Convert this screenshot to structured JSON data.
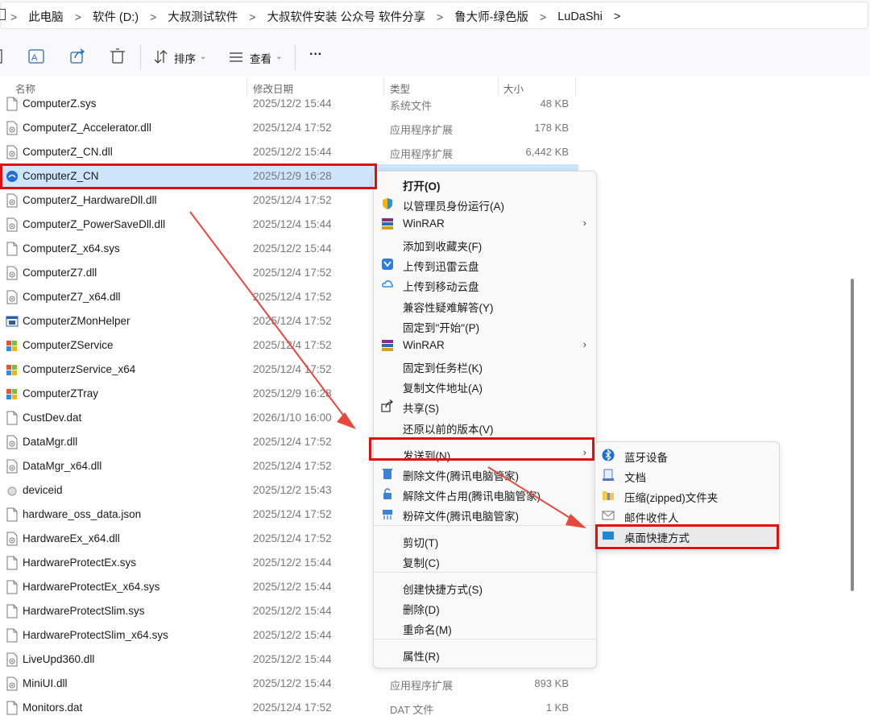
{
  "breadcrumb": [
    "此电脑",
    "软件 (D:)",
    "大叔测试软件",
    "大叔软件安装 公众号 软件分享",
    "鲁大师-绿色版",
    "LuDaShi"
  ],
  "toolbar": {
    "sort_label": "排序",
    "view_label": "查看",
    "more_label": "···"
  },
  "columns": {
    "name": "名称",
    "date": "修改日期",
    "type": "类型",
    "size": "大小"
  },
  "files": [
    {
      "name": "ComputerZ.sys",
      "date": "2025/12/2 15:44",
      "type": "系统文件",
      "size": "48 KB",
      "icon": "file-icon"
    },
    {
      "name": "ComputerZ_Accelerator.dll",
      "date": "2025/12/4 17:52",
      "type": "应用程序扩展",
      "size": "178 KB",
      "icon": "dll-icon"
    },
    {
      "name": "ComputerZ_CN.dll",
      "date": "2025/12/2 15:44",
      "type": "应用程序扩展",
      "size": "6,442 KB",
      "icon": "dll-icon"
    },
    {
      "name": "ComputerZ_CN",
      "date": "2025/12/9 16:28",
      "type": "",
      "size": "",
      "icon": "ludashi-app-icon"
    },
    {
      "name": "ComputerZ_HardwareDll.dll",
      "date": "2025/12/4 17:52",
      "type": "",
      "size": "",
      "icon": "dll-icon"
    },
    {
      "name": "ComputerZ_PowerSaveDll.dll",
      "date": "2025/12/4 15:44",
      "type": "",
      "size": "",
      "icon": "dll-icon"
    },
    {
      "name": "ComputerZ_x64.sys",
      "date": "2025/12/2 15:44",
      "type": "",
      "size": "",
      "icon": "file-icon"
    },
    {
      "name": "ComputerZ7.dll",
      "date": "2025/12/4 17:52",
      "type": "",
      "size": "",
      "icon": "dll-icon"
    },
    {
      "name": "ComputerZ7_x64.dll",
      "date": "2025/12/4 17:52",
      "type": "",
      "size": "",
      "icon": "dll-icon"
    },
    {
      "name": "ComputerZMonHelper",
      "date": "2025/12/4 17:52",
      "type": "",
      "size": "",
      "icon": "app-window-icon"
    },
    {
      "name": "ComputerZService",
      "date": "2025/12/4 17:52",
      "type": "",
      "size": "",
      "icon": "windows-app-icon"
    },
    {
      "name": "ComputerzService_x64",
      "date": "2025/12/4 17:52",
      "type": "",
      "size": "",
      "icon": "windows-app-icon"
    },
    {
      "name": "ComputerZTray",
      "date": "2025/12/9 16:28",
      "type": "",
      "size": "",
      "icon": "windows-app-icon"
    },
    {
      "name": "CustDev.dat",
      "date": "2026/1/10 16:00",
      "type": "",
      "size": "",
      "icon": "file-icon"
    },
    {
      "name": "DataMgr.dll",
      "date": "2025/12/4 17:52",
      "type": "",
      "size": "",
      "icon": "dll-icon"
    },
    {
      "name": "DataMgr_x64.dll",
      "date": "2025/12/4 17:52",
      "type": "",
      "size": "",
      "icon": "dll-icon"
    },
    {
      "name": "deviceid",
      "date": "2025/12/2 15:43",
      "type": "",
      "size": "",
      "icon": "generic-icon"
    },
    {
      "name": "hardware_oss_data.json",
      "date": "2025/12/4 17:52",
      "type": "",
      "size": "",
      "icon": "file-icon"
    },
    {
      "name": "HardwareEx_x64.dll",
      "date": "2025/12/4 17:52",
      "type": "",
      "size": "",
      "icon": "dll-icon"
    },
    {
      "name": "HardwareProtectEx.sys",
      "date": "2025/12/2 15:44",
      "type": "",
      "size": "",
      "icon": "file-icon"
    },
    {
      "name": "HardwareProtectEx_x64.sys",
      "date": "2025/12/2 15:44",
      "type": "",
      "size": "",
      "icon": "file-icon"
    },
    {
      "name": "HardwareProtectSlim.sys",
      "date": "2025/12/2 15:44",
      "type": "",
      "size": "",
      "icon": "file-icon"
    },
    {
      "name": "HardwareProtectSlim_x64.sys",
      "date": "2025/12/2 15:44",
      "type": "",
      "size": "",
      "icon": "file-icon"
    },
    {
      "name": "LiveUpd360.dll",
      "date": "2025/12/2 15:44",
      "type": "",
      "size": "",
      "icon": "dll-icon"
    },
    {
      "name": "MiniUI.dll",
      "date": "2025/12/2 15:44",
      "type": "应用程序扩展",
      "size": "893 KB",
      "icon": "dll-icon"
    },
    {
      "name": "Monitors.dat",
      "date": "2025/12/4 17:52",
      "type": "DAT 文件",
      "size": "1 KB",
      "icon": "file-icon"
    }
  ],
  "selected_index": 3,
  "context_menu": [
    {
      "label": "打开(O)",
      "bold": true,
      "icon": "",
      "submenu": false
    },
    {
      "label": "以管理员身份运行(A)",
      "icon": "shield-icon",
      "submenu": false
    },
    {
      "label": "WinRAR",
      "icon": "winrar-icon",
      "submenu": true
    },
    {
      "label": "添加到收藏夹(F)",
      "icon": "",
      "submenu": false
    },
    {
      "label": "上传到迅雷云盘",
      "icon": "xunlei-icon",
      "submenu": false
    },
    {
      "label": "上传到移动云盘",
      "icon": "cloud-icon",
      "submenu": false
    },
    {
      "label": "兼容性疑难解答(Y)",
      "icon": "",
      "submenu": false
    },
    {
      "label": "固定到\"开始\"(P)",
      "icon": "",
      "submenu": false
    },
    {
      "label": "WinRAR",
      "icon": "winrar-icon",
      "submenu": true
    },
    {
      "label": "固定到任务栏(K)",
      "icon": "",
      "submenu": false
    },
    {
      "label": "复制文件地址(A)",
      "icon": "",
      "submenu": false
    },
    {
      "label": "共享(S)",
      "icon": "share-icon",
      "submenu": false
    },
    {
      "label": "还原以前的版本(V)",
      "icon": "",
      "submenu": false
    },
    {
      "label": "发送到(N)",
      "icon": "",
      "submenu": true
    },
    {
      "label": "删除文件(腾讯电脑管家)",
      "icon": "tencent-delete-icon",
      "submenu": false
    },
    {
      "label": "解除文件占用(腾讯电脑管家)",
      "icon": "tencent-unlock-icon",
      "submenu": false
    },
    {
      "label": "粉碎文件(腾讯电脑管家)",
      "icon": "tencent-shred-icon",
      "submenu": false
    },
    {
      "label": "剪切(T)",
      "icon": "",
      "submenu": false
    },
    {
      "label": "复制(C)",
      "icon": "",
      "submenu": false
    },
    {
      "label": "创建快捷方式(S)",
      "icon": "",
      "submenu": false
    },
    {
      "label": "删除(D)",
      "icon": "",
      "submenu": false
    },
    {
      "label": "重命名(M)",
      "icon": "",
      "submenu": false
    },
    {
      "label": "属性(R)",
      "icon": "",
      "submenu": false
    }
  ],
  "send_to_menu": [
    {
      "label": "蓝牙设备",
      "icon": "bluetooth-icon"
    },
    {
      "label": "文档",
      "icon": "document-icon"
    },
    {
      "label": "压缩(zipped)文件夹",
      "icon": "zip-folder-icon"
    },
    {
      "label": "邮件收件人",
      "icon": "mail-icon"
    },
    {
      "label": "桌面快捷方式",
      "icon": "desktop-icon"
    }
  ],
  "colors": {
    "highlight": "#e01010",
    "selection": "#cde6fb",
    "arrow": "#e8483c"
  }
}
